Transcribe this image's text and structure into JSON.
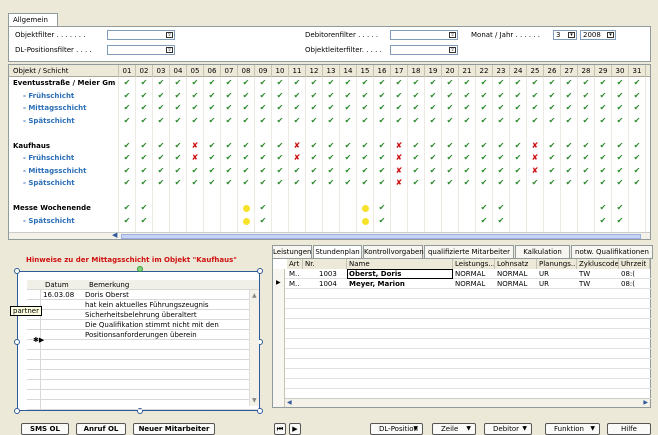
{
  "tab_main": "Allgemein",
  "filters": {
    "objektfilter": "Objektfilter . . . . . . .",
    "dl_positionsfilter": "DL-Positionsfilter . . . .",
    "debitorenfilter": "Debitorenfilter . . . . .",
    "objektleiterfilter": "Objektleiterfilter. . . . .",
    "monat_jahr": "Monat / Jahr . . . . . .",
    "monat": "3",
    "jahr": "2008"
  },
  "grid": {
    "first_col": "Objekt / Schicht",
    "days": [
      "01",
      "02",
      "03",
      "04",
      "05",
      "06",
      "07",
      "08",
      "09",
      "10",
      "11",
      "12",
      "13",
      "14",
      "15",
      "16",
      "17",
      "18",
      "19",
      "20",
      "21",
      "22",
      "23",
      "24",
      "25",
      "26",
      "27",
      "28",
      "29",
      "30",
      "31"
    ],
    "rows": [
      {
        "label": "Eventusstraße / Meier Gm",
        "type": "object",
        "marks": "vvvvvvvvvvvvvvvvvvvvvvvvvvvvvvv"
      },
      {
        "label": "- Frühschicht",
        "type": "shift",
        "marks": "vvvvvvvvvvvvvvvvvvvvvvvvvvvvvvv"
      },
      {
        "label": "- Mittagsschicht",
        "type": "shift",
        "marks": "vvvvvvvvvvvvvvvvvvvvvvvvvvvvvvv"
      },
      {
        "label": "- Spätschicht",
        "type": "shift",
        "marks": "vvvvvvvvvvvvvvvvvvvvvvvvvvvvvvv"
      },
      {
        "label": "",
        "type": "blank",
        "marks": ""
      },
      {
        "label": "Kaufhaus",
        "type": "object",
        "marks": "vvvvxvvvvvxvvvvvxvvvvvvvxvvvvvv"
      },
      {
        "label": "- Frühschicht",
        "type": "shift",
        "marks": "vvvvxvvvvvxvvvvvxvvvvvvvxvvvvvv"
      },
      {
        "label": "- Mittagsschicht",
        "type": "shift",
        "marks": "vvvvvvvvvvvvvvvvxvvvvvvvxvvvvvv"
      },
      {
        "label": "- Spätschicht",
        "type": "shift",
        "marks": "vvvvvvvvvvvvvvvvxvvvvvvvvvvvvvv"
      },
      {
        "label": "",
        "type": "blank",
        "marks": ""
      },
      {
        "label": "Messe Wochenende",
        "type": "object",
        "marks": "vv.....ov.....ov.....vv.....vv."
      },
      {
        "label": "- Spätschicht",
        "type": "shift",
        "marks": "vv.....ov.....ov.....vv.....vv."
      }
    ]
  },
  "hint": "Hinweise zu der Mittagsschicht im Objekt \"Kaufhaus\"",
  "notes": {
    "col_datum": "Datum",
    "col_bemerkung": "Bemerkung",
    "tooltip": "partner",
    "rows": [
      {
        "datum": "16.03.08",
        "text": "Doris Oberst"
      },
      {
        "datum": "",
        "text": "hat kein aktuelles Führungszeugnis"
      },
      {
        "datum": "",
        "text": "Sicherheitsbelehrung überaltert"
      },
      {
        "datum": "",
        "text": "Die Qualifikation stimmt nicht mit den"
      },
      {
        "datum": "",
        "text": "Positionsanforderungen überein"
      }
    ]
  },
  "buttons": {
    "sms": "SMS OL",
    "anruf": "Anruf OL",
    "neuer": "Neuer Mitarbeiter",
    "dl_position": "DL-Position",
    "zeile": "Zeile",
    "debitor": "Debitor",
    "funktion": "Funktion",
    "hilfe": "Hilfe"
  },
  "right_tabs": [
    "Leistungen",
    "Stundenplan",
    "Kontrollvorgaben",
    "qualifizierte Mitarbeiter",
    "Kalkulation",
    "notw. Qualifikationen"
  ],
  "right_table": {
    "headers": [
      "Art",
      "Nr.",
      "Name",
      "Leistungs...",
      "Lohnsatz",
      "Planungs...",
      "Zykluscode",
      "Uhrzeit"
    ],
    "rows": [
      {
        "art": "M..",
        "nr": "1003",
        "name": "Oberst, Doris",
        "leist": "NORMAL",
        "lohn": "NORMAL",
        "plan": "UR",
        "zyklus": "TW",
        "uhr": "08:("
      },
      {
        "art": "M..",
        "nr": "1004",
        "name": "Meyer, Marion",
        "leist": "NORMAL",
        "lohn": "NORMAL",
        "plan": "UR",
        "zyklus": "TW",
        "uhr": "08:("
      }
    ]
  }
}
